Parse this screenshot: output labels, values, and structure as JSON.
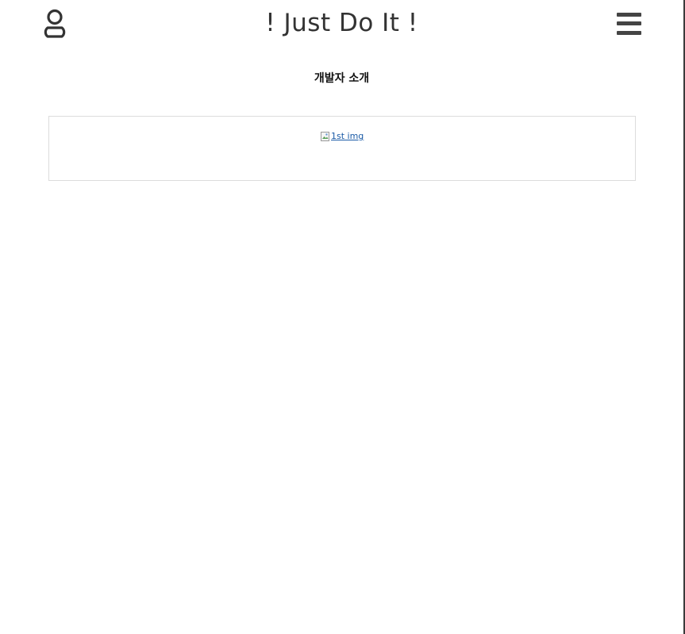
{
  "header": {
    "title": "! Just Do It !",
    "user_icon": "user-icon",
    "menu_icon": "hamburger-menu-icon"
  },
  "main": {
    "section_title": "개발자 소개",
    "image": {
      "alt": "1st img",
      "icon": "broken-image-icon"
    }
  },
  "colors": {
    "text": "#333333",
    "link": "#1a5aa6",
    "border": "#dcdcdc"
  }
}
